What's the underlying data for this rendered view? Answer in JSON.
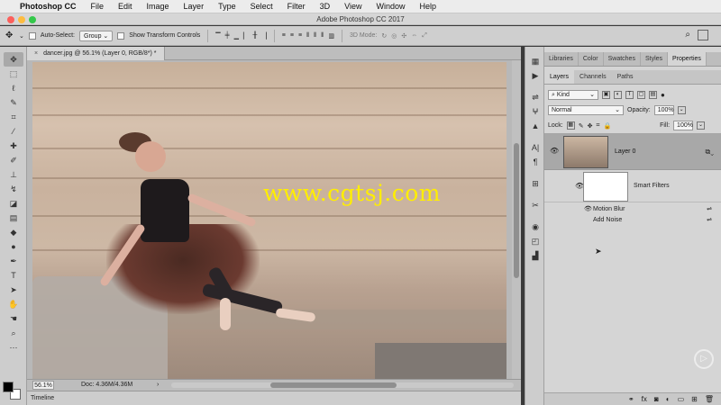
{
  "menubar": {
    "items": [
      "Photoshop CC",
      "File",
      "Edit",
      "Image",
      "Layer",
      "Type",
      "Select",
      "Filter",
      "3D",
      "View",
      "Window",
      "Help"
    ]
  },
  "window": {
    "title": "Adobe Photoshop CC 2017"
  },
  "options_bar": {
    "auto_select_label": "Auto-Select:",
    "auto_select_value": "Group",
    "transform_controls_label": "Show Transform Controls",
    "mode_label": "3D Mode:"
  },
  "document": {
    "tab_title": "dancer.jpg @ 56.1% (Layer 0, RGB/8*) *",
    "watermark": "www.cgtsj.com",
    "zoom": "56.1%",
    "doc_info": "Doc: 4.36M/4.36M"
  },
  "timeline": {
    "label": "Timeline"
  },
  "panel": {
    "top_tabs": [
      "Libraries",
      "Color",
      "Swatches",
      "Styles",
      "Properties"
    ],
    "active_top_tab": "Properties",
    "layer_tabs": [
      "Layers",
      "Channels",
      "Paths"
    ],
    "active_layer_tab": "Layers",
    "filter_kind": "Kind",
    "blend_mode": "Normal",
    "opacity_label": "Opacity:",
    "opacity_value": "100%",
    "lock_label": "Lock:",
    "fill_label": "Fill:",
    "fill_value": "100%",
    "layer_name": "Layer 0",
    "smart_filters_label": "Smart Filters",
    "filters": [
      "Motion Blur",
      "Add Noise"
    ]
  },
  "colors": {
    "foreground": "#000000",
    "background": "#ffffff",
    "watermark": "#ffee00"
  }
}
